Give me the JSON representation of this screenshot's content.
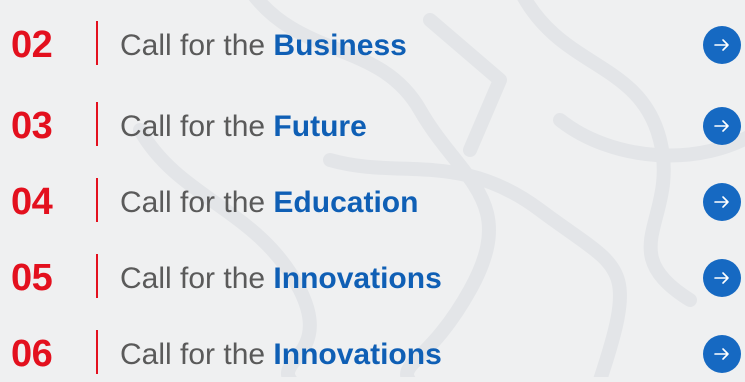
{
  "items": [
    {
      "number": "02",
      "prefix": "Call for the",
      "topic": "Business"
    },
    {
      "number": "03",
      "prefix": "Call for the",
      "topic": "Future"
    },
    {
      "number": "04",
      "prefix": "Call for the",
      "topic": "Education"
    },
    {
      "number": "05",
      "prefix": "Call for the",
      "topic": "Innovations"
    },
    {
      "number": "06",
      "prefix": "Call for the",
      "topic": "Innovations"
    }
  ],
  "icons": {
    "arrow": "arrow-right-icon"
  },
  "colors": {
    "number": "#e3101e",
    "topic": "#0f5fb5",
    "text": "#5a5a5a",
    "button": "#1669c2",
    "background": "#eff0f1"
  }
}
